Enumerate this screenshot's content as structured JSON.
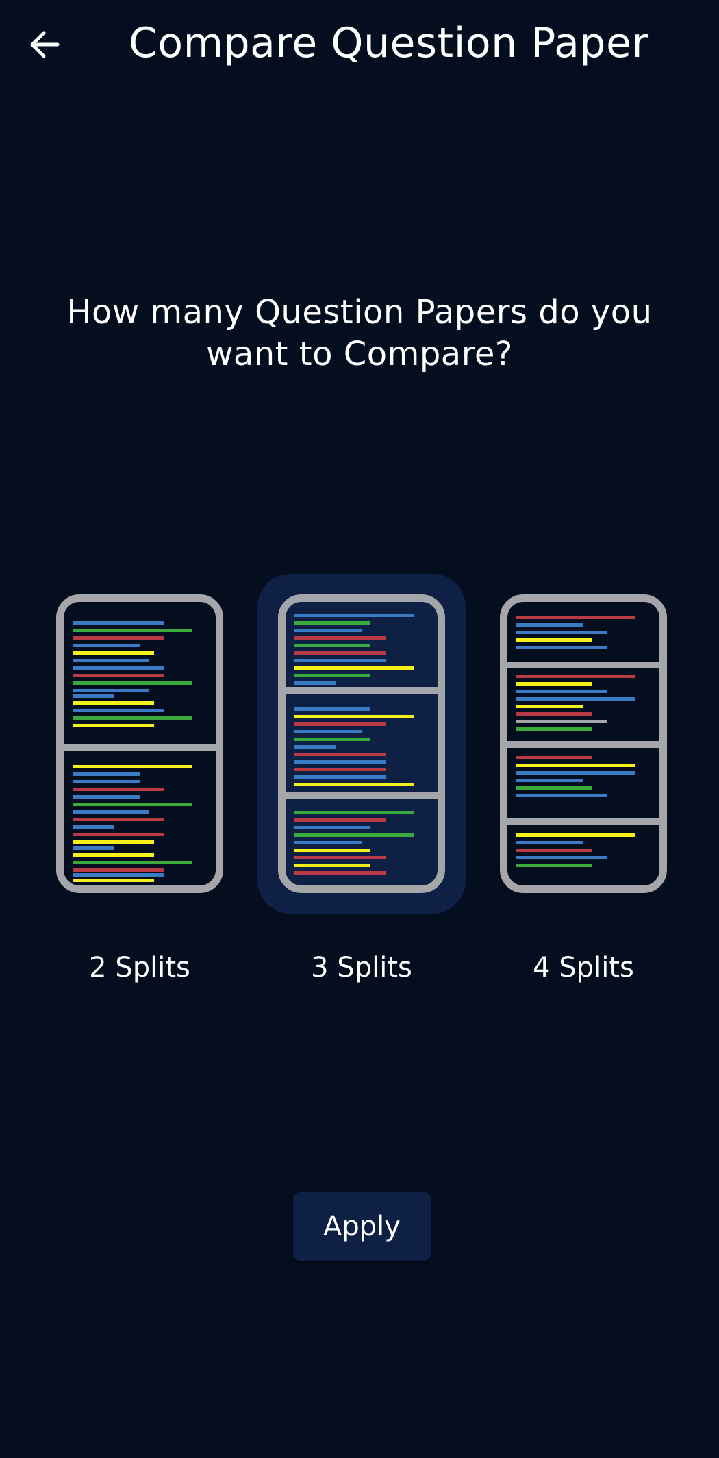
{
  "header": {
    "title": "Compare Question Paper",
    "back_icon": "arrow-left-icon"
  },
  "question": "How many Question Papers do you want to Compare?",
  "options": [
    {
      "label": "2 Splits",
      "splits": 2,
      "selected": false
    },
    {
      "label": "3 Splits",
      "splits": 3,
      "selected": true
    },
    {
      "label": "4 Splits",
      "splits": 4,
      "selected": false
    }
  ],
  "apply_label": "Apply",
  "colors": {
    "background": "#050e1f",
    "selected_bg": "#0e2144",
    "frame": "#a4a6aa",
    "line_blue": "#3b7bc4",
    "line_green": "#3aaa3e",
    "line_red": "#b83a44",
    "line_yellow": "#f5f01a",
    "line_gray": "#a4a6aa"
  }
}
